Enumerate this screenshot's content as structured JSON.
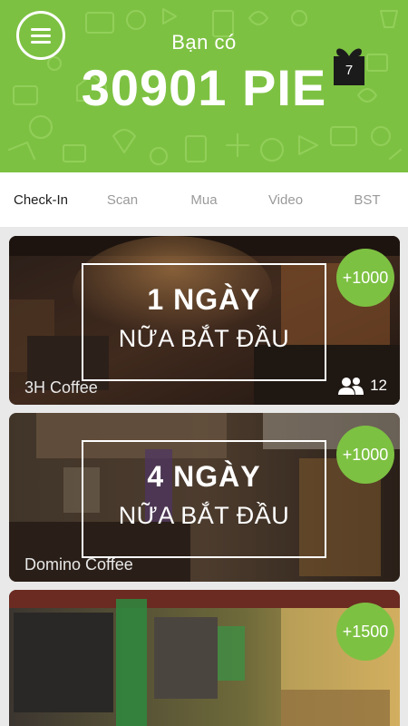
{
  "header": {
    "balance_label": "Bạn có",
    "balance_value": "30901 PIE",
    "gift_count": "7",
    "background_color": "#7dc142"
  },
  "tabs": [
    {
      "label": "Check-In",
      "active": true
    },
    {
      "label": "Scan",
      "active": false
    },
    {
      "label": "Mua",
      "active": false
    },
    {
      "label": "Video",
      "active": false
    },
    {
      "label": "BST",
      "active": false
    }
  ],
  "cards": [
    {
      "days": "1 NGÀY",
      "subtitle": "NỮA BẮT ĐẦU",
      "venue": "3H Coffee",
      "reward": "+1000",
      "participants": "12"
    },
    {
      "days": "4 NGÀY",
      "subtitle": "NỮA BẮT ĐẦU",
      "venue": "Domino Coffee",
      "reward": "+1000"
    },
    {
      "reward": "+1500"
    }
  ],
  "icons": {
    "menu": "hamburger-menu-icon",
    "gift": "gift-box-icon",
    "participants": "people-icon"
  }
}
